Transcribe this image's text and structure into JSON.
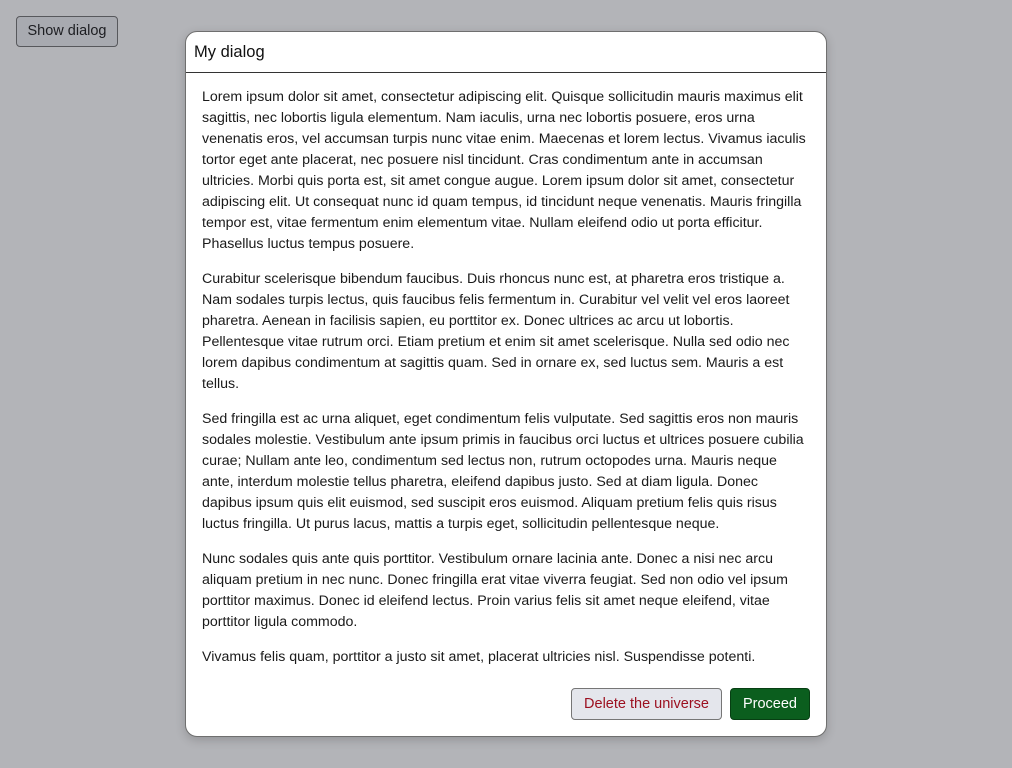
{
  "page": {
    "show_dialog_label": "Show dialog"
  },
  "dialog": {
    "title": "My dialog",
    "paragraphs": [
      "Lorem ipsum dolor sit amet, consectetur adipiscing elit. Quisque sollicitudin mauris maximus elit sagittis, nec lobortis ligula elementum. Nam iaculis, urna nec lobortis posuere, eros urna venenatis eros, vel accumsan turpis nunc vitae enim. Maecenas et lorem lectus. Vivamus iaculis tortor eget ante placerat, nec posuere nisl tincidunt. Cras condimentum ante in accumsan ultricies. Morbi quis porta est, sit amet congue augue. Lorem ipsum dolor sit amet, consectetur adipiscing elit. Ut consequat nunc id quam tempus, id tincidunt neque venenatis. Mauris fringilla tempor est, vitae fermentum enim elementum vitae. Nullam eleifend odio ut porta efficitur. Phasellus luctus tempus posuere.",
      "Curabitur scelerisque bibendum faucibus. Duis rhoncus nunc est, at pharetra eros tristique a. Nam sodales turpis lectus, quis faucibus felis fermentum in. Curabitur vel velit vel eros laoreet pharetra. Aenean in facilisis sapien, eu porttitor ex. Donec ultrices ac arcu ut lobortis. Pellentesque vitae rutrum orci. Etiam pretium et enim sit amet scelerisque. Nulla sed odio nec lorem dapibus condimentum at sagittis quam. Sed in ornare ex, sed luctus sem. Mauris a est tellus.",
      "Sed fringilla est ac urna aliquet, eget condimentum felis vulputate. Sed sagittis eros non mauris sodales molestie. Vestibulum ante ipsum primis in faucibus orci luctus et ultrices posuere cubilia curae; Nullam ante leo, condimentum sed lectus non, rutrum octopodes urna. Mauris neque ante, interdum molestie tellus pharetra, eleifend dapibus justo. Sed at diam ligula. Donec dapibus ipsum quis elit euismod, sed suscipit eros euismod. Aliquam pretium felis quis risus luctus fringilla. Ut purus lacus, mattis a turpis eget, sollicitudin pellentesque neque.",
      "Nunc sodales quis ante quis porttitor. Vestibulum ornare lacinia ante. Donec a nisi nec arcu aliquam pretium in nec nunc. Donec fringilla erat vitae viverra feugiat. Sed non odio vel ipsum porttitor maximus. Donec id eleifend lectus. Proin varius felis sit amet neque eleifend, vitae porttitor ligula commodo.",
      "Vivamus felis quam, porttitor a justo sit amet, placerat ultricies nisl. Suspendisse potenti."
    ],
    "delete_label": "Delete the universe",
    "proceed_label": "Proceed"
  },
  "colors": {
    "backdrop": "#b3b4b8",
    "danger_text": "#9b0f1f",
    "primary_button": "#0b5e1e"
  }
}
